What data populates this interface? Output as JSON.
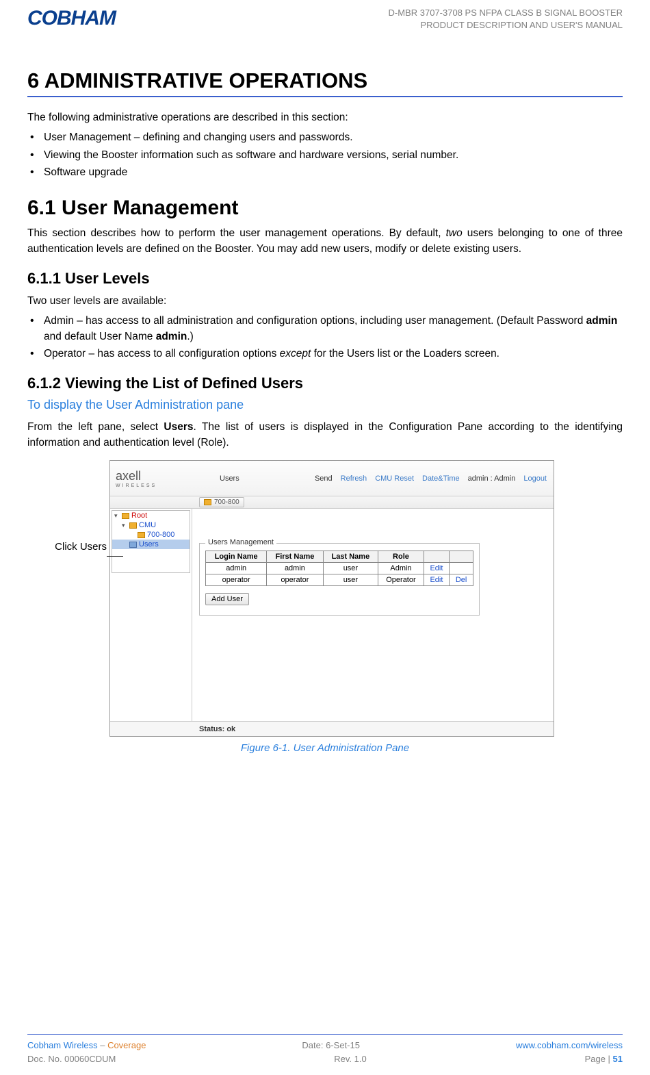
{
  "header": {
    "logo": "COBHAM",
    "line1": "D-MBR 3707-3708 PS NFPA CLASS B SIGNAL BOOSTER",
    "line2": "PRODUCT DESCRIPTION AND USER'S MANUAL"
  },
  "section6": {
    "heading": "6   ADMINISTRATIVE OPERATIONS",
    "intro": "The following administrative operations are described in this section:",
    "bullets": [
      "User Management – defining and changing users and passwords.",
      "Viewing the Booster information such as software and hardware versions, serial number.",
      "Software upgrade"
    ]
  },
  "section61": {
    "heading": "6.1   User Management",
    "para_pre": "This section describes how to perform the user management operations. By default, ",
    "para_em": "two",
    "para_post": " users belonging to one of three authentication levels are defined on the Booster. You may add new users, modify or delete existing users."
  },
  "section611": {
    "heading": "6.1.1   User Levels",
    "intro": "Two user levels are available:",
    "b1_pre": "Admin – has access to all administration and configuration options, including user management. (Default Password ",
    "b1_bold1": "admin",
    "b1_mid": " and default User Name ",
    "b1_bold2": "admin",
    "b1_post": ".)",
    "b2_pre": "Operator – has access to all configuration options ",
    "b2_em": "except",
    "b2_post": " for the Users list or the Loaders screen."
  },
  "section612": {
    "heading": "6.1.2   Viewing the List of Defined Users",
    "sub": "To display the User Administration pane",
    "p_pre": "From the left pane, select ",
    "p_bold": "Users",
    "p_post": ". The list of users is displayed in the Configuration Pane according to the identifying information and authentication level (Role)."
  },
  "figure": {
    "click_label": "Click Users",
    "caption": "Figure 6-1. User Administration Pane"
  },
  "app": {
    "logo": "axell",
    "logo_sub": "WIRELESS",
    "breadcrumb": "Users",
    "actions": {
      "send": "Send",
      "refresh": "Refresh",
      "cmu_reset": "CMU Reset",
      "date_time": "Date&Time",
      "user_role": "admin : Admin",
      "logout": "Logout"
    },
    "toolbar_item": "700-800",
    "tree": {
      "root": "Root",
      "cmu": "CMU",
      "band": "700-800",
      "users": "Users"
    },
    "panel_title": "Users Management",
    "table": {
      "headers": [
        "Login Name",
        "First Name",
        "Last Name",
        "Role"
      ],
      "rows": [
        {
          "login": "admin",
          "first": "admin",
          "last": "user",
          "role": "Admin",
          "edit": "Edit",
          "del": ""
        },
        {
          "login": "operator",
          "first": "operator",
          "last": "user",
          "role": "Operator",
          "edit": "Edit",
          "del": "Del"
        }
      ]
    },
    "add_user": "Add User",
    "status": "Status: ok"
  },
  "footer": {
    "left1a": "Cobham Wireless",
    "left1b": " – ",
    "left1c": "Coverage",
    "mid1": "Date: 6-Set-15",
    "right1": "www.cobham.com/wireless",
    "left2": "Doc. No. 00060CDUM",
    "mid2": "Rev. 1.0",
    "right2a": "Page | ",
    "right2b": "51"
  }
}
